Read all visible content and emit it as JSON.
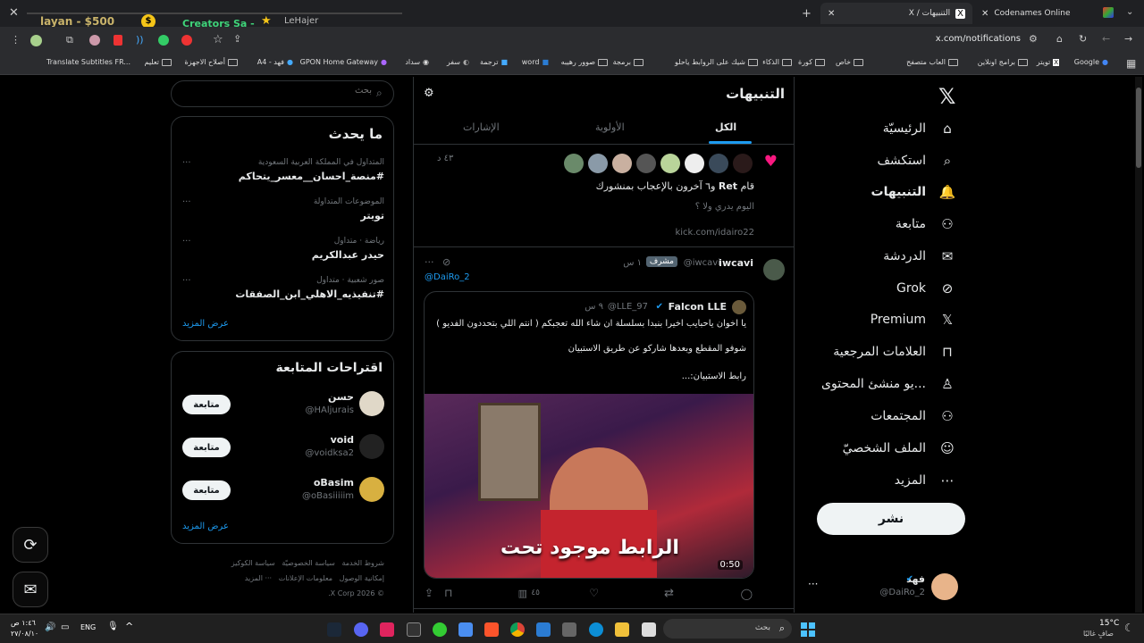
{
  "browser": {
    "close_label": "✕",
    "tabs": [
      {
        "title": "Codenames Online"
      },
      {
        "title": "X / التنبيهات"
      }
    ],
    "new_tab_label": "+",
    "ticker": {
      "name": "layan - $500",
      "name2": "Creators Sa -",
      "name3": "LeHajer"
    },
    "address": "x.com/notifications",
    "bookmarks": [
      "Google",
      "تويتر",
      "برامج اونلاين",
      "العاب متصفح",
      "خاص",
      "كورة",
      "الذكاء",
      "شيك على الروابط ياحلو",
      "برمجة",
      "صوور رهيبه",
      "word",
      "ترجمة",
      "سفر",
      "سداد",
      "GPON Home Gateway",
      "A4 - فهد",
      "أصلاح الاجهزة",
      "تعليم",
      "Translate Subtitles FR..."
    ]
  },
  "nav": {
    "items": [
      {
        "label": "الرئيسيّة",
        "icon": "home-icon"
      },
      {
        "label": "استكشف",
        "icon": "search-icon"
      },
      {
        "label": "التنبيهات",
        "icon": "bell-icon"
      },
      {
        "label": "متابعة",
        "icon": "person-add-icon"
      },
      {
        "label": "الدردشة",
        "icon": "mail-icon"
      },
      {
        "label": "Grok",
        "icon": "grok-icon"
      },
      {
        "label": "Premium",
        "icon": "x-icon"
      },
      {
        "label": "العلامات المرجعية",
        "icon": "bookmark-icon"
      },
      {
        "label": "...يو منشئ المحتوى",
        "icon": "creator-icon"
      },
      {
        "label": "المجتمعات",
        "icon": "communities-icon"
      },
      {
        "label": "الملف الشخصيّ",
        "icon": "profile-icon"
      },
      {
        "label": "المزيد",
        "icon": "more-icon"
      }
    ],
    "post_button": "نشر",
    "account": {
      "name": "فهد",
      "handle": "@DaiRo_2",
      "more": "···"
    }
  },
  "main": {
    "title": "التنبيهات",
    "tabs": [
      "الكل",
      "الأولوية",
      "الإشارات"
    ],
    "like_notification": {
      "time": "٤٣ د",
      "text_prefix": "قام ",
      "text_name": "Ret",
      "text_suffix": " و٦ آخرون بالإعجاب بمنشورك",
      "post_text": "اليوم يدري ولا ؟",
      "post_link": "kick.com/idairo22"
    },
    "reply": {
      "name": "iwcavi",
      "handle": "@iwcavi",
      "badge": "مشرف",
      "time": "١ س",
      "replying_to": "@DaiRo_2",
      "quote": {
        "name": "Falcon LLE",
        "handle": "@LLE_97",
        "time": "٩ س",
        "text1": "يا اخوان ياحبايب اخيرا بنبدا بسلسلة ان شاء الله تعجبكم ( انتم اللي بتحددون الفديو )",
        "text2": "شوفو المقطع وبعدها شاركو عن طريق الاستبيان",
        "text3": "رابط الاستبيان:...",
        "video_caption": "الرابط موجود تحت",
        "video_duration": "0:50"
      },
      "views": "٤٥"
    }
  },
  "right": {
    "search_placeholder": "بحث",
    "trends_title": "ما يحدث",
    "trends": [
      {
        "context": "المتداول في المملكة العربية السعودية",
        "name": "#منصة_احسان__معسر_يتحاكم"
      },
      {
        "context": "الموضوعات المتداولة",
        "name": "تويتر"
      },
      {
        "context": "رياضة · متداول",
        "name": "حيدر عبدالكريم"
      },
      {
        "context": "صور شعبية · متداول",
        "name": "#تنفيذيه_الاهلي_ابن_الصفقات"
      }
    ],
    "show_more": "عرض المزيد",
    "follow_title": "اقتراحات المتابعة",
    "follow": [
      {
        "name": "حسن",
        "handle": "@HAljurais",
        "button": "متابعة"
      },
      {
        "name": "void",
        "handle": "@voidksa2",
        "button": "متابعة"
      },
      {
        "name": "oBasim",
        "handle": "@oBasiiiiim",
        "button": "متابعة"
      }
    ],
    "follow_more": "عرض المزيد",
    "footer": [
      "شروط الخدمة",
      "سياسة الخصوصيّة",
      "سياسة الكوكيز",
      "إمكانية الوصول",
      "معلومات الإعلانات",
      "··· المزيد",
      "© 2026 X Corp."
    ]
  },
  "taskbar": {
    "search_placeholder": "بحث",
    "weather_temp": "15°C",
    "weather_text": "صافٍ غالبًا",
    "lang": "ENG",
    "time": "١:٤٦ ص",
    "date": "٢٧/٠٨/١٠"
  }
}
